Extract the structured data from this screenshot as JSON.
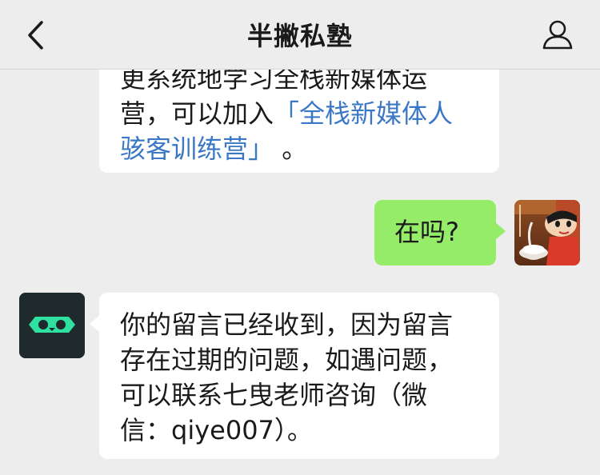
{
  "nav": {
    "title": "半撇私塾",
    "back_icon": "chevron-left-icon",
    "profile_icon": "user-icon"
  },
  "messages": [
    {
      "side": "left",
      "lines": [
        "更系统地学习全栈新媒体运",
        "营，可以加入"
      ],
      "link_part1": "「全栈新媒体人",
      "link_part2": "骇客训练营」",
      "suffix": " 。"
    },
    {
      "side": "right",
      "text": "在吗?"
    },
    {
      "side": "left",
      "lines": [
        "你的留言已经收到，因为留言",
        "存在过期的问题，如遇问题，",
        "可以联系七曳老师咨询（微",
        "信：qiye007）。"
      ]
    }
  ],
  "colors": {
    "background": "#ededed",
    "bubble_left": "#ffffff",
    "bubble_right": "#95ec69",
    "link": "#3a78c6",
    "bot_avatar_bg": "#1f2a2c",
    "bot_avatar_accent": "#2fe0a0"
  },
  "avatars": {
    "user": "cartoon-boy-avatar",
    "bot": "owl-eyes-logo"
  }
}
